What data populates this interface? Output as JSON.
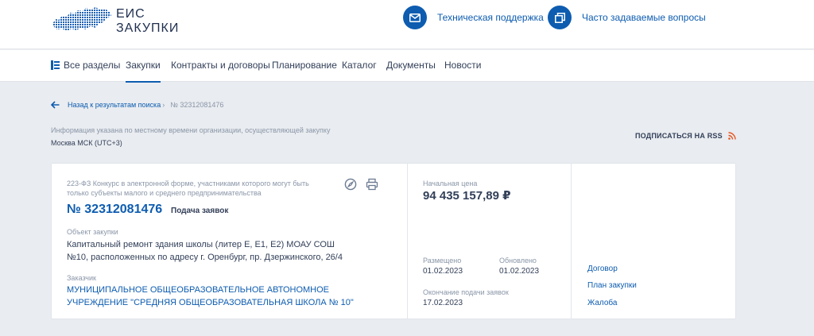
{
  "header": {
    "logo_line1": "ЕИС",
    "logo_line2": "ЗАКУПКИ",
    "support_label": "Техническая поддержка",
    "faq_label": "Часто задаваемые вопросы",
    "accent_color": "#0d5cb0"
  },
  "nav": {
    "items": [
      {
        "label": "Все разделы",
        "icon": "sections-icon"
      },
      {
        "label": "Закупки",
        "active": true
      },
      {
        "label": "Контракты и договоры"
      },
      {
        "label": "Планирование"
      },
      {
        "label": "Каталог"
      },
      {
        "label": "Документы"
      },
      {
        "label": "Новости"
      }
    ]
  },
  "breadcrumb": {
    "back_label": "Назад к результатам поиска",
    "separator": "›",
    "current": "№ 32312081476"
  },
  "timezone": {
    "note": "Информация указана по местному времени организации, осуществляющей закупку",
    "value": "Москва МСК (UTC+3)"
  },
  "rss": {
    "label": "ПОДПИСАТЬСЯ НА RSS",
    "color": "#e8551f"
  },
  "purchase": {
    "law_text": "223-ФЗ Конкурс в электронной форме, участниками которого могут быть только субъекты малого и среднего предпринимательства",
    "number": "№ 32312081476",
    "stage": "Подача заявок",
    "object_label": "Объект закупки",
    "object_text": "Капитальный ремонт здания школы (литер Е, Е1, Е2) МОАУ СОШ №10, расположенных по адресу г. Оренбург, пр. Дзержинского, 26/4",
    "customer_label": "Заказчик",
    "customer_text": "МУНИЦИПАЛЬНОЕ ОБЩЕОБРАЗОВАТЕЛЬНОЕ АВТОНОМНОЕ УЧРЕЖДЕНИЕ \"СРЕДНЯЯ ОБЩЕОБРАЗОВАТЕЛЬНАЯ ШКОЛА № 10\"",
    "price_label": "Начальная цена",
    "price": "94 435 157,89 ₽",
    "posted_label": "Размещено",
    "posted": "01.02.2023",
    "updated_label": "Обновлено",
    "updated": "01.02.2023",
    "deadline_label": "Окончание подачи заявок",
    "deadline": "17.02.2023"
  },
  "side_links": {
    "contract": "Договор",
    "plan": "План закупки",
    "complaint": "Жалоба"
  }
}
